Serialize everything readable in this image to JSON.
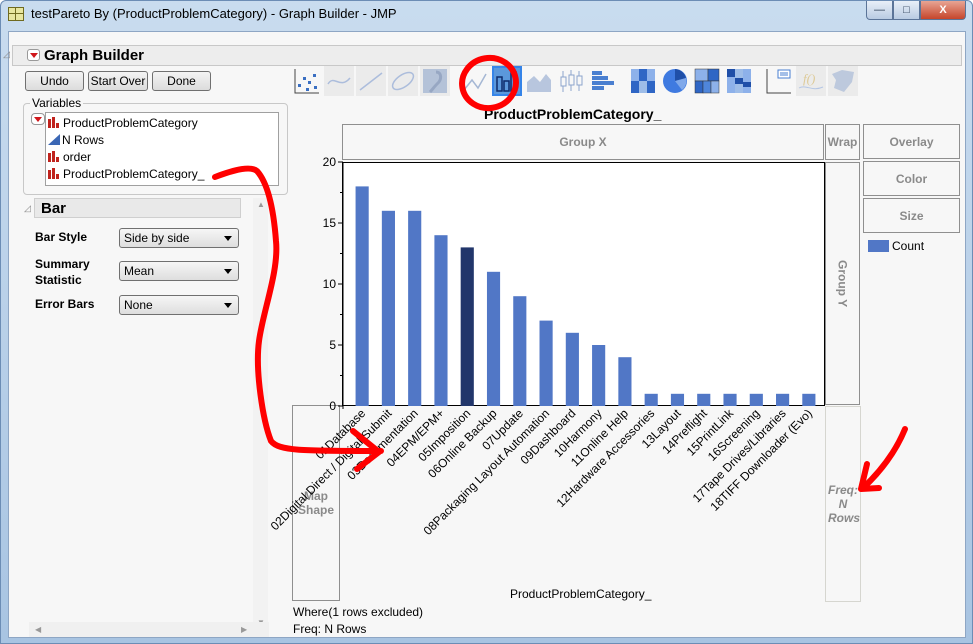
{
  "window": {
    "title": "testPareto By (ProductProblemCategory) - Graph Builder - JMP",
    "controls": {
      "minimize": "—",
      "maximize": "□",
      "close": "X"
    }
  },
  "graph_builder": {
    "title": "Graph Builder",
    "buttons": {
      "undo": "Undo",
      "start_over": "Start Over",
      "done": "Done"
    }
  },
  "variables": {
    "label": "Variables",
    "items": [
      {
        "name": "ProductProblemCategory",
        "type": "nominal"
      },
      {
        "name": "N Rows",
        "type": "continuous"
      },
      {
        "name": "order",
        "type": "nominal"
      },
      {
        "name": "ProductProblemCategory_",
        "type": "nominal"
      }
    ]
  },
  "bar_panel": {
    "title": "Bar",
    "options": [
      {
        "label": "Bar Style",
        "value": "Side by side"
      },
      {
        "label": "Summary Statistic",
        "value": "Mean"
      },
      {
        "label": "Error Bars",
        "value": "None"
      }
    ]
  },
  "element_toolbar": {
    "items": [
      "points",
      "smoother",
      "line-of-fit",
      "ellipse",
      "contour",
      "line",
      "bar",
      "area",
      "box-plot",
      "histogram",
      "heatmap",
      "pie",
      "treemap",
      "mosaic",
      "caption-box",
      "formula",
      "map-shapes"
    ],
    "selected": "bar"
  },
  "zones": {
    "group_x": "Group X",
    "wrap": "Wrap",
    "overlay": "Overlay",
    "color": "Color",
    "size": "Size",
    "group_y": "Group Y",
    "map_shape": "Map Shape",
    "freq": "Freq: N Rows"
  },
  "legend": {
    "label": "Count",
    "color": "#5177c6"
  },
  "footnotes": {
    "where": "Where(1 rows excluded)",
    "freq": "Freq: N Rows"
  },
  "colors": {
    "bar": "#5177c6",
    "bar_highlight": "#22366b",
    "annotation": "#ff0000"
  },
  "chart_data": {
    "type": "bar",
    "title": "ProductProblemCategory_",
    "xlabel": "ProductProblemCategory_",
    "ylabel": "",
    "ylim": [
      0,
      20
    ],
    "yticks": [
      0,
      5,
      10,
      15,
      20
    ],
    "grid": false,
    "legend": "right",
    "categories": [
      "01Database",
      "02Digital Direct / Digital Submit",
      "03Documentation",
      "04EPM/EPM+",
      "05Imposition",
      "06Online Backup",
      "07Update",
      "08Packaging Layout Automation",
      "09Dashboard",
      "10Harmony",
      "11Online Help",
      "12Hardware Accessories",
      "13Layout",
      "14Preflight",
      "15PrintLink",
      "16Screening",
      "17Tape Drives/Libraries",
      "18TIFF Downloader (Evo)"
    ],
    "series": [
      {
        "name": "Count",
        "values": [
          18,
          16,
          16,
          14,
          13,
          11,
          9,
          7,
          6,
          5,
          4,
          1,
          1,
          1,
          1,
          1,
          1,
          1
        ]
      }
    ],
    "highlighted_index": 4
  }
}
